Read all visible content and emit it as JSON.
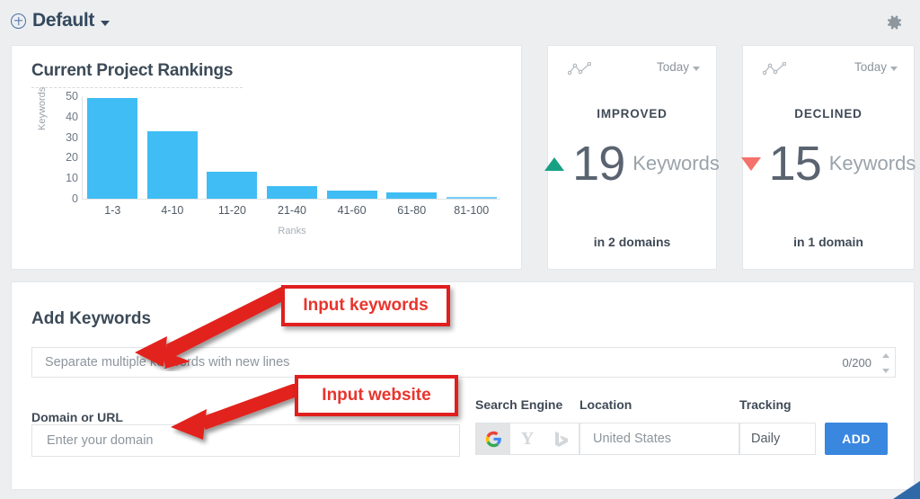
{
  "topbar": {
    "project_name": "Default",
    "add_icon": "plus-circle-icon",
    "caret_icon": "chevron-down-icon",
    "settings_icon": "gear-icon"
  },
  "chart_card": {
    "title": "Current Project Rankings"
  },
  "chart_data": {
    "type": "bar",
    "title": "Current Project Rankings",
    "categories": [
      "1-3",
      "4-10",
      "11-20",
      "21-40",
      "41-60",
      "61-80",
      "81-100"
    ],
    "values": [
      49,
      33,
      13,
      6,
      4,
      3,
      1
    ],
    "xlabel": "Ranks",
    "ylabel": "Keywords",
    "ylim": [
      0,
      50
    ],
    "yticks": [
      50,
      40,
      30,
      20,
      10,
      0
    ],
    "grid": false,
    "legend": "none",
    "bar_color": "#3fbdf4"
  },
  "stat_cards": [
    {
      "icon": "line-chart-icon",
      "period": "Today",
      "period_caret": "chevron-down-icon",
      "heading": "IMPROVED",
      "direction_icon": "triangle-up-icon",
      "direction_color": "#18a085",
      "value": "19",
      "unit": "Keywords",
      "footer": "in 2 domains"
    },
    {
      "icon": "line-chart-icon",
      "period": "Today",
      "period_caret": "chevron-down-icon",
      "heading": "DECLINED",
      "direction_icon": "triangle-down-icon",
      "direction_color": "#f4726b",
      "value": "15",
      "unit": "Keywords",
      "footer": "in 1 domain"
    }
  ],
  "add_keywords": {
    "title": "Add Keywords",
    "keywords_placeholder": "Separate multiple keywords with new lines",
    "keywords_value": "",
    "counter": "0/200",
    "domain_label": "Domain or URL",
    "domain_placeholder": "Enter your domain",
    "domain_value": "",
    "search_engine_label": "Search Engine",
    "engines": [
      {
        "name": "google-icon",
        "label": "G",
        "selected": true
      },
      {
        "name": "yahoo-icon",
        "label": "Y",
        "selected": false
      },
      {
        "name": "bing-icon",
        "label": "b",
        "selected": false
      }
    ],
    "location_label": "Location",
    "location_value": "United States",
    "tracking_label": "Tracking",
    "tracking_value": "Daily",
    "add_button": "ADD"
  },
  "annotations": [
    {
      "text": "Input keywords",
      "color": "#e8342d",
      "border_color": "#e01f1f"
    },
    {
      "text": "Input website",
      "color": "#e8342d",
      "border_color": "#e01f1f"
    }
  ]
}
